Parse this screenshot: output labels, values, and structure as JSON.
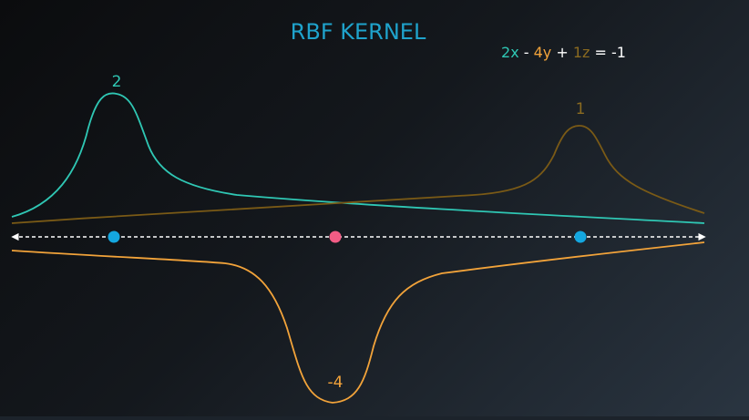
{
  "title": "RBF KERNEL",
  "equation": {
    "coef1": "2",
    "var1": "x",
    "op1": " - ",
    "coef2": "4",
    "var2": "y",
    "op2": " + ",
    "coef3": "1",
    "var3": "z",
    "rhs": " = -1"
  },
  "peak_labels": {
    "teal": "2",
    "brown": "1",
    "orange": "-4"
  },
  "colors": {
    "title": "#1fa3cc",
    "teal": "#2fc7b4",
    "brown": "#7a5a16",
    "brown_label": "#8a6a20",
    "orange": "#f2a33a",
    "white": "#ffffff",
    "blue_point": "#14a7e0",
    "pink_point": "#f25c85"
  },
  "points": [
    {
      "name": "point-blue-left",
      "color": "blue"
    },
    {
      "name": "point-pink-center",
      "color": "pink"
    },
    {
      "name": "point-blue-right",
      "color": "blue"
    }
  ]
}
